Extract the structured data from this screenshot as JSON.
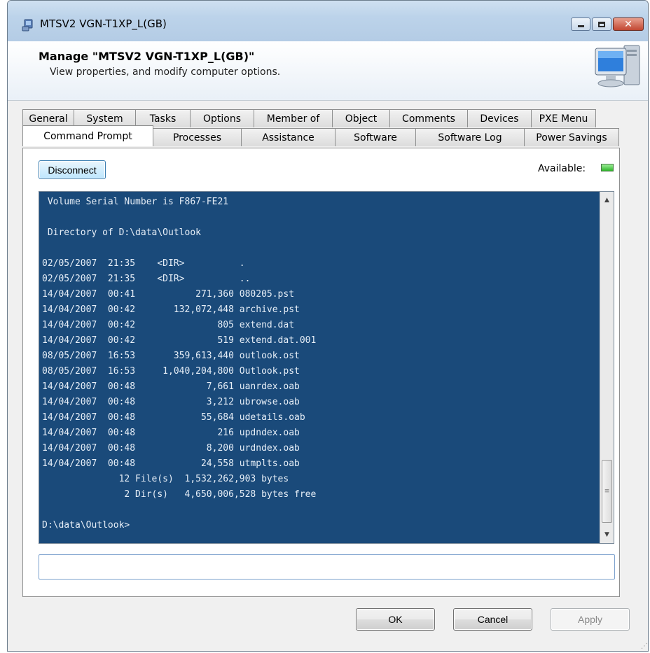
{
  "window": {
    "title": "MTSV2 VGN-T1XP_L(GB)",
    "controls": {
      "minimize": "minimize",
      "maximize": "maximize",
      "close": "✕"
    }
  },
  "header": {
    "title": "Manage \"MTSV2 VGN-T1XP_L(GB)\"",
    "subtitle": "View properties, and modify computer options."
  },
  "tabs": {
    "row1": [
      "General",
      "System",
      "Tasks",
      "Options",
      "Member of",
      "Object",
      "Comments",
      "Devices",
      "PXE Menu"
    ],
    "row2": [
      "Command Prompt",
      "Processes",
      "Assistance",
      "Software",
      "Software Log",
      "Power Savings"
    ],
    "active": "Command Prompt"
  },
  "toolbar": {
    "disconnect_label": "Disconnect",
    "available_label": "Available:",
    "available_color": "#2fb52a"
  },
  "console": {
    "background": "#1a4a7a",
    "lines": [
      " Volume Serial Number is F867-FE21",
      "",
      " Directory of D:\\data\\Outlook",
      "",
      "02/05/2007  21:35    <DIR>          .",
      "02/05/2007  21:35    <DIR>          ..",
      "14/04/2007  00:41           271,360 080205.pst",
      "14/04/2007  00:42       132,072,448 archive.pst",
      "14/04/2007  00:42               805 extend.dat",
      "14/04/2007  00:42               519 extend.dat.001",
      "08/05/2007  16:53       359,613,440 outlook.ost",
      "08/05/2007  16:53     1,040,204,800 Outlook.pst",
      "14/04/2007  00:48             7,661 uanrdex.oab",
      "14/04/2007  00:48             3,212 ubrowse.oab",
      "14/04/2007  00:48            55,684 udetails.oab",
      "14/04/2007  00:48               216 updndex.oab",
      "14/04/2007  00:48             8,200 urdndex.oab",
      "14/04/2007  00:48            24,558 utmplts.oab",
      "              12 File(s)  1,532,262,903 bytes",
      "               2 Dir(s)   4,650,006,528 bytes free",
      "",
      "D:\\data\\Outlook>"
    ]
  },
  "command_input": {
    "value": ""
  },
  "buttons": {
    "ok": "OK",
    "cancel": "Cancel",
    "apply": "Apply"
  }
}
